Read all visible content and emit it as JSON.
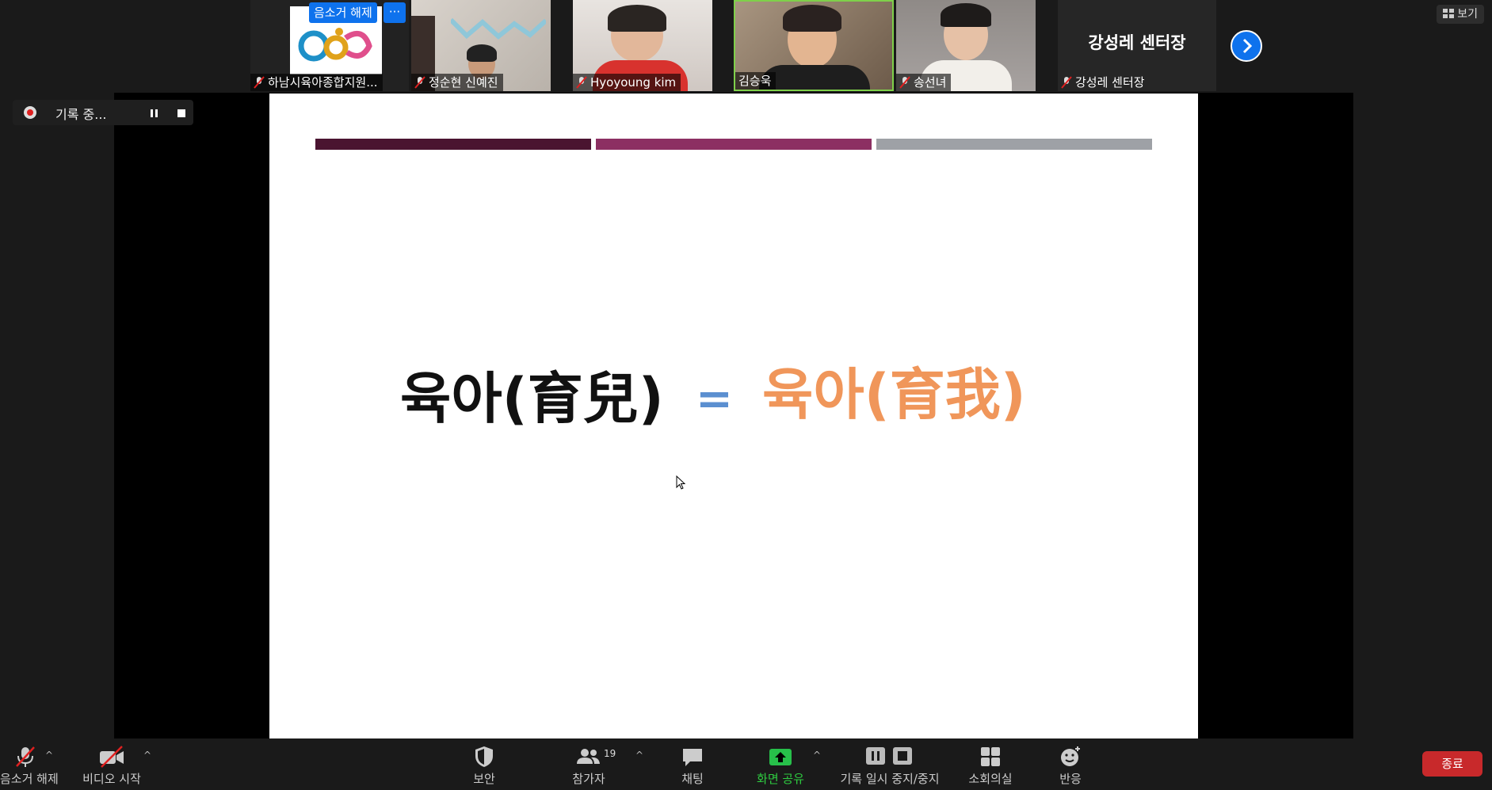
{
  "thumbnails": [
    {
      "name": "하남시육아종합지원...",
      "muted": true,
      "overlay_button": "음소거 해제",
      "overlay_more": "···"
    },
    {
      "name": "정순현 신예진",
      "muted": true
    },
    {
      "name": "Hyoyoung kim",
      "muted": true
    },
    {
      "name": "김승욱",
      "muted": false,
      "active_speaker": true
    },
    {
      "name": "송선녀",
      "muted": true
    },
    {
      "name": "강성레 센터장",
      "muted": true,
      "display_text": "강성레 센터장"
    }
  ],
  "view_button": "보기",
  "recording": {
    "label": "기록 중..."
  },
  "slide": {
    "left_text": "육아(育兒)",
    "equals": "=",
    "right_text": "육아(育我)",
    "colors": {
      "left": "#111111",
      "equals": "#5b8fd0",
      "right": "#f0965a",
      "bar1": "#4a1430",
      "bar2": "#8c2f62",
      "bar3": "#9ea1a6"
    }
  },
  "toolbar": {
    "mute": "음소거 해제",
    "video": "비디오 시작",
    "security": "보안",
    "participants": "참가자",
    "participants_count": "19",
    "chat": "채팅",
    "share": "화면 공유",
    "record": "기록 일시 중지/중지",
    "breakout": "소회의실",
    "reactions": "반응",
    "end": "종료"
  }
}
